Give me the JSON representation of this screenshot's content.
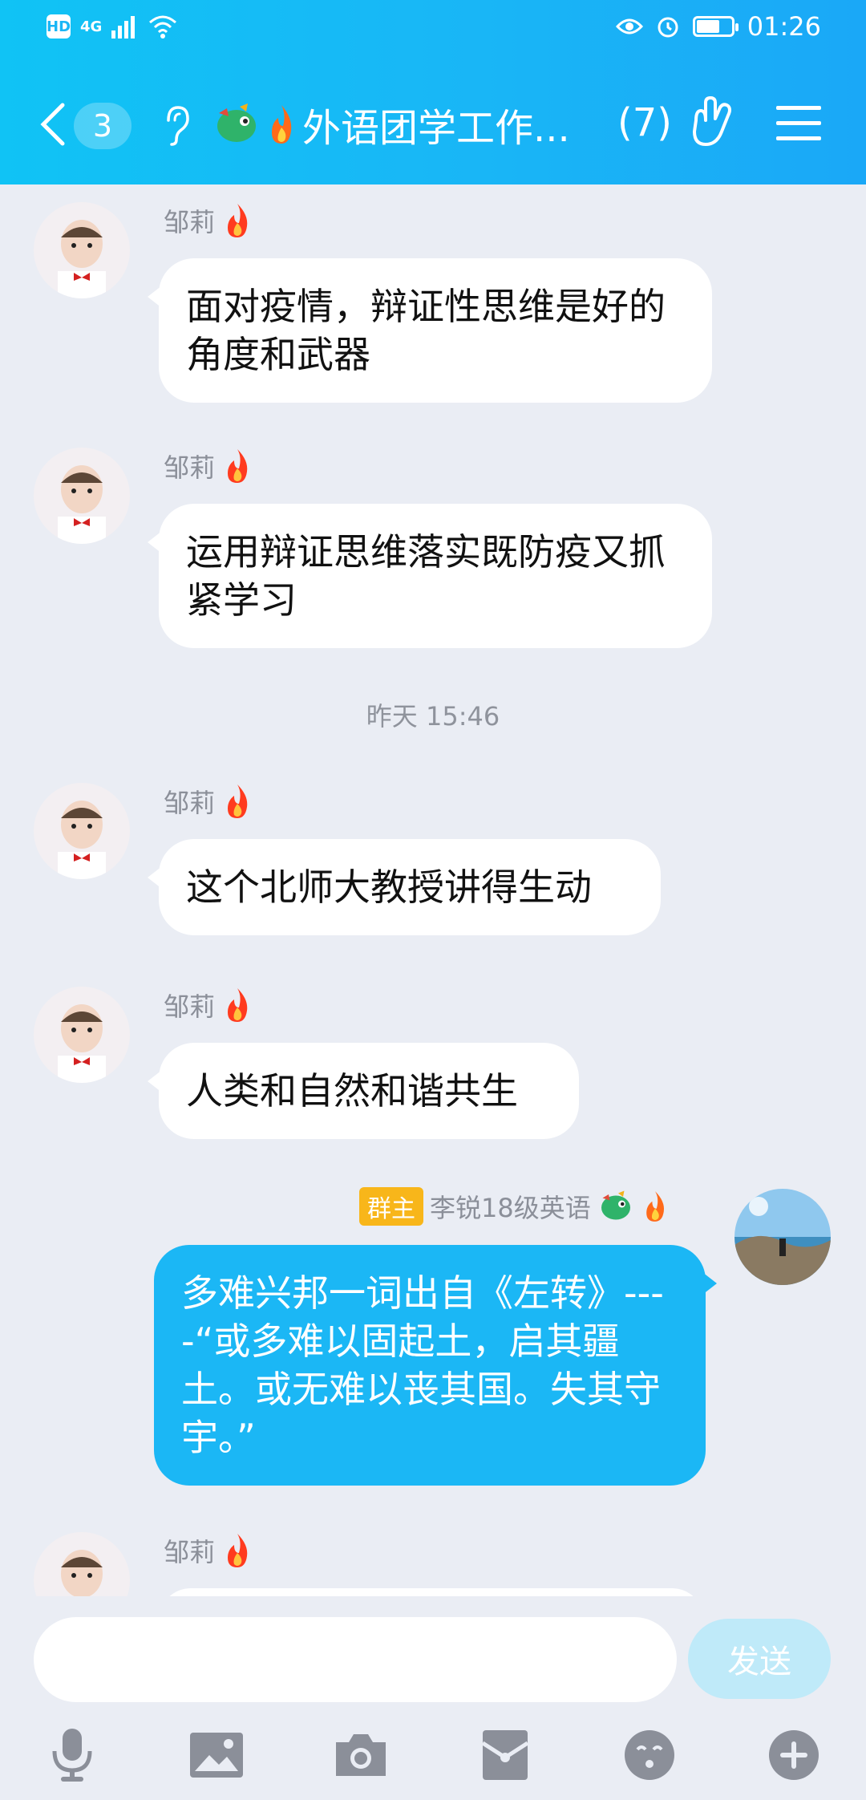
{
  "statusbar": {
    "hd": "HD",
    "signal": "4G",
    "time": "01:26"
  },
  "header": {
    "back_count": "3",
    "title": "外语团学工作...",
    "member_count": "(7)"
  },
  "chat": {
    "messages": [
      {
        "sender": "邹莉",
        "text": "面对疫情，辩证性思维是好的角度和武器"
      },
      {
        "sender": "邹莉",
        "text": "运用辩证思维落实既防疫又抓紧学习"
      },
      {
        "sender": "邹莉",
        "text": "这个北师大教授讲得生动"
      },
      {
        "sender": "邹莉",
        "text": "人类和自然和谐共生"
      },
      {
        "sender": "李锐18级英语",
        "role": "群主",
        "text": "多难兴邦一词出自《左转》----“或多难以固起土，启其疆土。或无难以丧其国。失其守宇。”"
      },
      {
        "sender": "邹莉"
      }
    ],
    "timestamp": "昨天 15:46"
  },
  "input": {
    "placeholder": "",
    "send_label": "发送"
  },
  "toolbar": [
    "mic-icon",
    "image-icon",
    "camera-icon",
    "red-packet-icon",
    "emoji-icon",
    "plus-icon"
  ],
  "colors": {
    "header": "#19b6f6",
    "bubble_mine": "#1bb7f5",
    "owner_badge": "#f8b61a",
    "bg": "#eaedf4"
  }
}
